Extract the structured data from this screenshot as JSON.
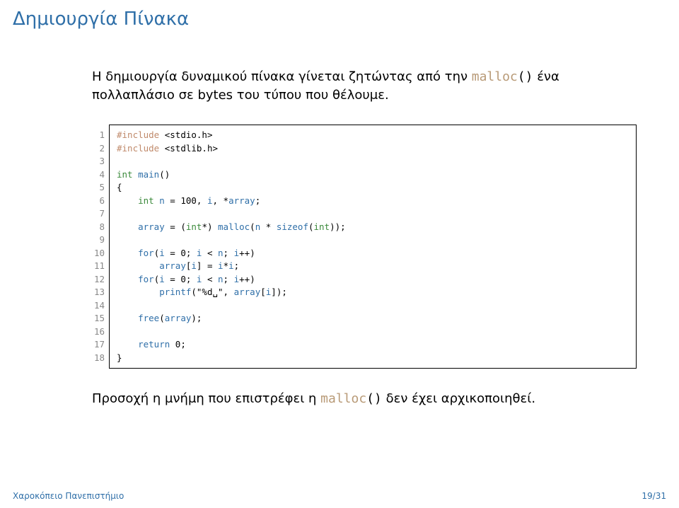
{
  "title": "Δημιουργία Πίνακα",
  "intro_part1": "Η δημιουργία δυναμικού πίνακα γίνεται ζητώντας από την ",
  "intro_malloc": "malloc",
  "intro_parens": "()",
  "intro_part2": " ένα πολλαπλάσιο σε bytes του τύπου που θέλουμε.",
  "code": {
    "lines": [
      {
        "n": "1",
        "html": "<span class=\"pp\">#include</span> &lt;stdio.h&gt;"
      },
      {
        "n": "2",
        "html": "<span class=\"pp\">#include</span> &lt;stdlib.h&gt;"
      },
      {
        "n": "3",
        "html": ""
      },
      {
        "n": "4",
        "html": "<span class=\"tp\">int</span> <span class=\"fn\">main</span>()"
      },
      {
        "n": "5",
        "html": "{"
      },
      {
        "n": "6",
        "html": "    <span class=\"tp\">int</span> <span class=\"fn\">n</span> = 100, <span class=\"fn\">i</span>, *<span class=\"fn\">array</span>;"
      },
      {
        "n": "7",
        "html": ""
      },
      {
        "n": "8",
        "html": "    <span class=\"fn\">array</span> = (<span class=\"tp\">int</span>*) <span class=\"fn\">malloc</span>(<span class=\"fn\">n</span> * <span class=\"kw\">sizeof</span>(<span class=\"tp\">int</span>));"
      },
      {
        "n": "9",
        "html": ""
      },
      {
        "n": "10",
        "html": "    <span class=\"kw\">for</span>(<span class=\"fn\">i</span> = 0; <span class=\"fn\">i</span> &lt; <span class=\"fn\">n</span>; <span class=\"fn\">i</span>++)"
      },
      {
        "n": "11",
        "html": "        <span class=\"fn\">array</span>[<span class=\"fn\">i</span>] = <span class=\"fn\">i</span>*<span class=\"fn\">i</span>;"
      },
      {
        "n": "12",
        "html": "    <span class=\"kw\">for</span>(<span class=\"fn\">i</span> = 0; <span class=\"fn\">i</span> &lt; <span class=\"fn\">n</span>; <span class=\"fn\">i</span>++)"
      },
      {
        "n": "13",
        "html": "        <span class=\"fn\">printf</span>(\"%d␣\", <span class=\"fn\">array</span>[<span class=\"fn\">i</span>]);"
      },
      {
        "n": "14",
        "html": ""
      },
      {
        "n": "15",
        "html": "    <span class=\"fn\">free</span>(<span class=\"fn\">array</span>);"
      },
      {
        "n": "16",
        "html": ""
      },
      {
        "n": "17",
        "html": "    <span class=\"kw\">return</span> 0;"
      },
      {
        "n": "18",
        "html": "}"
      }
    ]
  },
  "outro_part1": "Προσοχή η μνήμη που επιστρέφει η ",
  "outro_malloc": "malloc",
  "outro_parens": "()",
  "outro_part2": " δεν έχει αρχικοποιηθεί.",
  "footer_left": "Χαροκόπειο Πανεπιστήμιο",
  "footer_right": "19/31"
}
